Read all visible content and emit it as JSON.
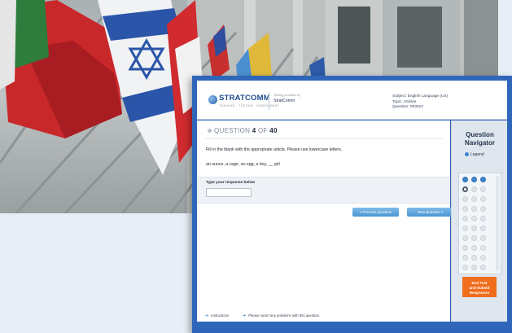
{
  "header": {
    "brand": "STRATCOMM",
    "brand_tagline": "TRAINING · TESTING · ASSESSMENT",
    "org_caption": "Testing provided by",
    "org_name": "StratComm",
    "subject": "Subject:  English Language (US)",
    "topic": "Topic:  Articles",
    "question_id": "Question:  #53010"
  },
  "question": {
    "label": "QUESTION",
    "current": "4",
    "of_label": "OF",
    "total": "40",
    "instruction": "Fill in the blank with the appropriate article.  Please use lowercase letters.",
    "prompt": "an ounce, a cage, an egg, a boy, __ girl"
  },
  "response": {
    "label": "Type your response below",
    "value": "",
    "placeholder": ""
  },
  "buttons": {
    "previous": "« Previous Question",
    "next": "Next Question  »",
    "end": "End Test\nand Submit\nResponses"
  },
  "footer": {
    "instructions": "Instructions",
    "report": "Please report any problems with this question."
  },
  "navigator": {
    "title_line1": "Question",
    "title_line2": "Navigator",
    "legend": "Legend",
    "answered_count": 3,
    "current_question": 4,
    "visible_questions": 30
  },
  "colors": {
    "frame": "#2f66b9",
    "accent_blue": "#3d86cf",
    "end_button": "#ef6d1c"
  },
  "icons": [
    "stratcomm-logo-icon",
    "question-bullet-icon",
    "arrow-right-icon",
    "legend-icon"
  ]
}
